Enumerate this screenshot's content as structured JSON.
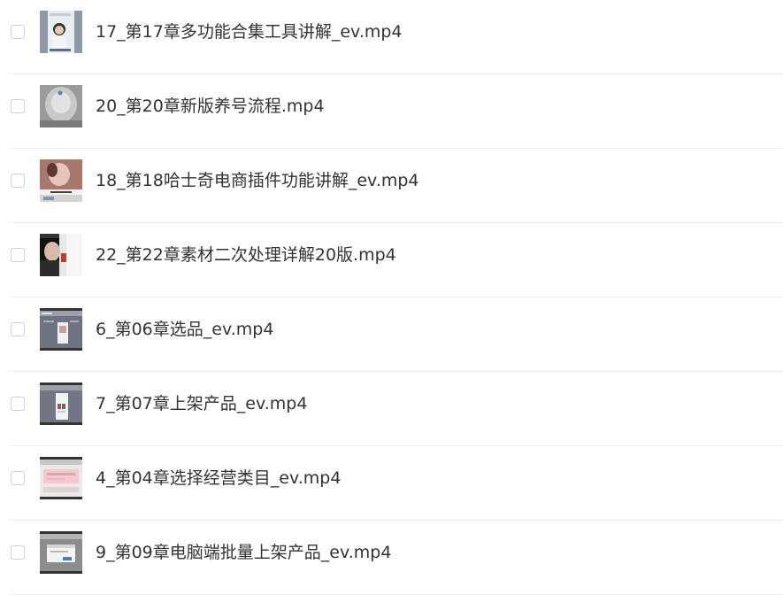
{
  "files": [
    {
      "name": "17_第17章多功能合集工具讲解_ev.mp4",
      "thumbnail": "video-thumbnail-person-phone-screen"
    },
    {
      "name": "20_第20章新版养号流程.mp4",
      "thumbnail": "video-thumbnail-grey-device"
    },
    {
      "name": "18_第18哈士奇电商插件功能讲解_ev.mp4",
      "thumbnail": "video-thumbnail-product-photo"
    },
    {
      "name": "22_第22章素材二次处理详解20版.mp4",
      "thumbnail": "video-thumbnail-dark-phone-screen"
    },
    {
      "name": "6_第06章选品_ev.mp4",
      "thumbnail": "video-thumbnail-desktop-screenshot"
    },
    {
      "name": "7_第07章上架产品_ev.mp4",
      "thumbnail": "video-thumbnail-desktop-screenshot"
    },
    {
      "name": "4_第04章选择经营类目_ev.mp4",
      "thumbnail": "video-thumbnail-pink-webpage"
    },
    {
      "name": "9_第09章电脑端批量上架产品_ev.mp4",
      "thumbnail": "video-thumbnail-dialog-screenshot"
    }
  ]
}
